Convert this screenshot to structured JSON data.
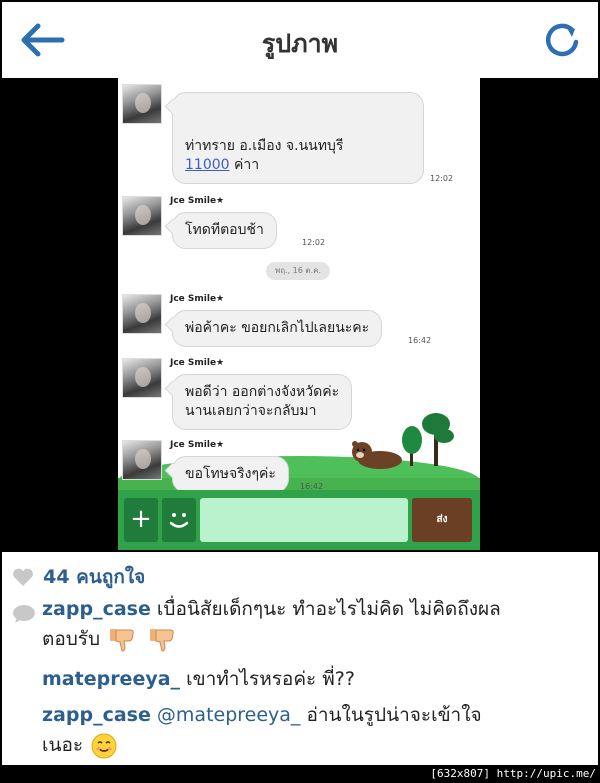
{
  "header": {
    "title": "รูปภาพ",
    "back_icon": "arrow-left-icon",
    "refresh_icon": "refresh-icon",
    "accent_color": "#2d6fb0"
  },
  "photo": {
    "messages": [
      {
        "sender": "",
        "line1": "ท่าทราย อ.เมือง จ.นนทบุรี",
        "link": "11000",
        "line2_rest": " ค่าา",
        "time": "12:02"
      },
      {
        "sender": "Jce Smile★",
        "text": "โทดทีตอบช้า",
        "time": "12:02"
      },
      {
        "sender": "Jce Smile★",
        "text": "พ่อค้าคะ ขอยกเลิกไปเลยนะคะ",
        "time": "16:42"
      },
      {
        "sender": "Jce Smile★",
        "line1": "พอดีว่า ออกต่างจังหวัดค่ะ",
        "line2": "นานเลยกว่าจะกลับมา",
        "time": ""
      },
      {
        "sender": "Jce Smile★",
        "text": "ขอโทษจริงๆค่ะ",
        "time": "16:42"
      }
    ],
    "date_separator": "พฤ., 16 ต.ค.",
    "input_bar": {
      "plus_label": "+",
      "send_label": "ส่ง"
    }
  },
  "info": {
    "likes": "44 คนถูกใจ",
    "comments": [
      {
        "user": "zapp_case",
        "line1": " เบื่อนิสัยเด็กๆนะ ทำอะไรไม่คิด ไม่คิดถึงผล",
        "line2": "ตอบรับ"
      },
      {
        "user": "matepreeya_",
        "text": " เขาทำไรหรอค่ะ พี่??"
      },
      {
        "user": "zapp_case",
        "mention": " @matepreeya_",
        "line1": " อ่านในรูปน่าจะเข้าใจ",
        "line2": "เนอะ"
      }
    ],
    "username_color": "#2d5f8e"
  },
  "footer": {
    "watermark": "[632x807] http://upic.me/"
  }
}
